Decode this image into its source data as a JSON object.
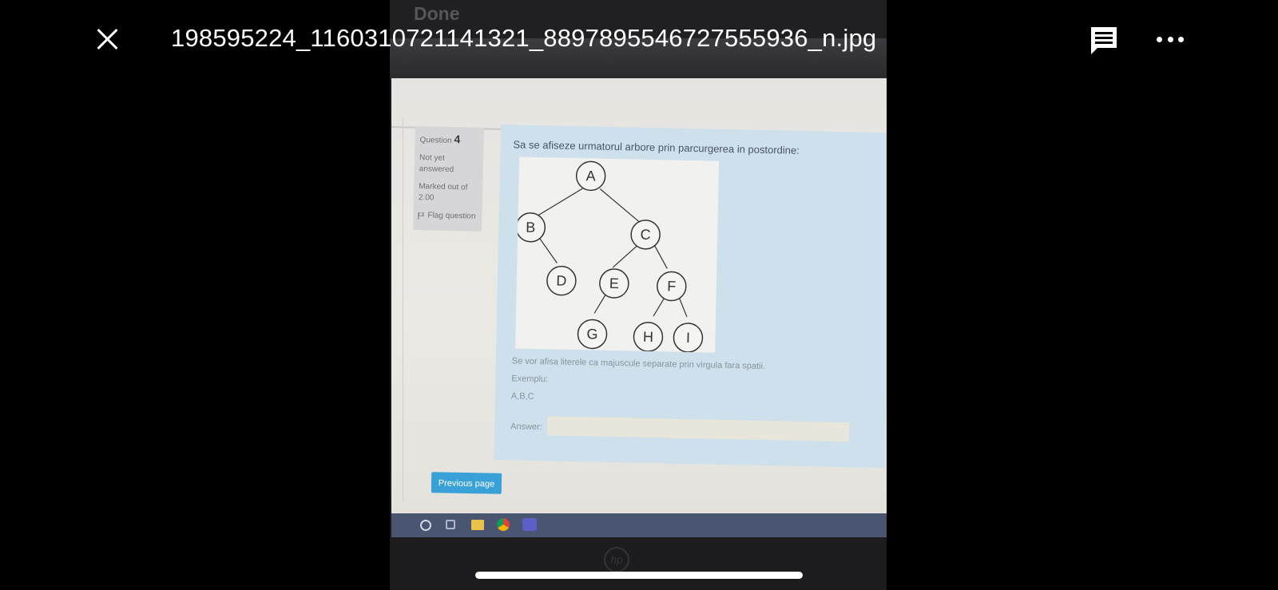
{
  "viewer": {
    "file_name": "198595224_1160310721141321_8897895546727555936_n.jpg",
    "close_icon": "close-icon",
    "comment_icon": "comment-icon",
    "more_icon": "more-options-icon"
  },
  "photo": {
    "done_label": "Done",
    "quiz": {
      "question_label": "Question",
      "question_number": "4",
      "state": "Not yet answered",
      "marked_out_of": "Marked out of 2.00",
      "flag_label": "Flag question",
      "question_text": "Sa se afiseze urmatorul arbore prin parcurgerea in postordine:",
      "tree_nodes": [
        "A",
        "B",
        "C",
        "D",
        "E",
        "F",
        "G",
        "H",
        "I"
      ],
      "instruction": "Se vor afisa literele ca majuscule separate prin virgula fara spatii.",
      "example_label": "Exemplu:",
      "example_value": "A,B,C",
      "answer_label": "Answer:",
      "answer_value": "",
      "previous_page_label": "Previous page"
    },
    "taskbar_icons": [
      "search-icon",
      "task-view-icon",
      "file-explorer-icon",
      "chrome-icon",
      "teams-icon"
    ],
    "logo_text": "hp"
  },
  "colors": {
    "question_panel": "#cde0ec",
    "button": "#3aa0d8",
    "taskbar": "#4a5572"
  }
}
